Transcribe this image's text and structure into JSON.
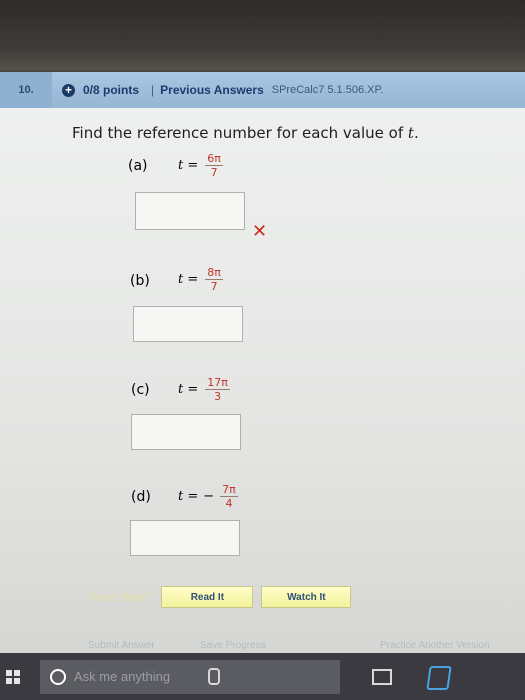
{
  "header": {
    "question_number": "10.",
    "points": "0/8 points",
    "separator": "|",
    "previous_answers": "Previous Answers",
    "problem_code": "SPreCalc7 5.1.506.XP."
  },
  "prompt": {
    "text": "Find the reference number for each value of",
    "variable": "t",
    "period": "."
  },
  "parts": [
    {
      "label": "(a)",
      "lhs": "t =",
      "sign": "",
      "numerator": "6π",
      "denominator": "7",
      "answer": "",
      "status": "incorrect"
    },
    {
      "label": "(b)",
      "lhs": "t =",
      "sign": "",
      "numerator": "8π",
      "denominator": "7",
      "answer": ""
    },
    {
      "label": "(c)",
      "lhs": "t =",
      "sign": "",
      "numerator": "17π",
      "denominator": "3",
      "answer": ""
    },
    {
      "label": "(d)",
      "lhs": "t =",
      "sign": "−",
      "numerator": "7π",
      "denominator": "4",
      "answer": ""
    }
  ],
  "wrong_mark": "✕",
  "help": {
    "need_help": "Need Help?",
    "read_it": "Read It",
    "watch_it": "Watch It"
  },
  "footer": {
    "submit": "Submit Answer",
    "save": "Save Progress",
    "practice": "Practice Another Version"
  },
  "taskbar": {
    "search_placeholder": "Ask me anything"
  },
  "colors": {
    "header_bg": "#a9c6e2",
    "fraction_red": "#c0362b",
    "wrong_red": "#d02a1e",
    "button_yellow": "#f2f19a"
  }
}
